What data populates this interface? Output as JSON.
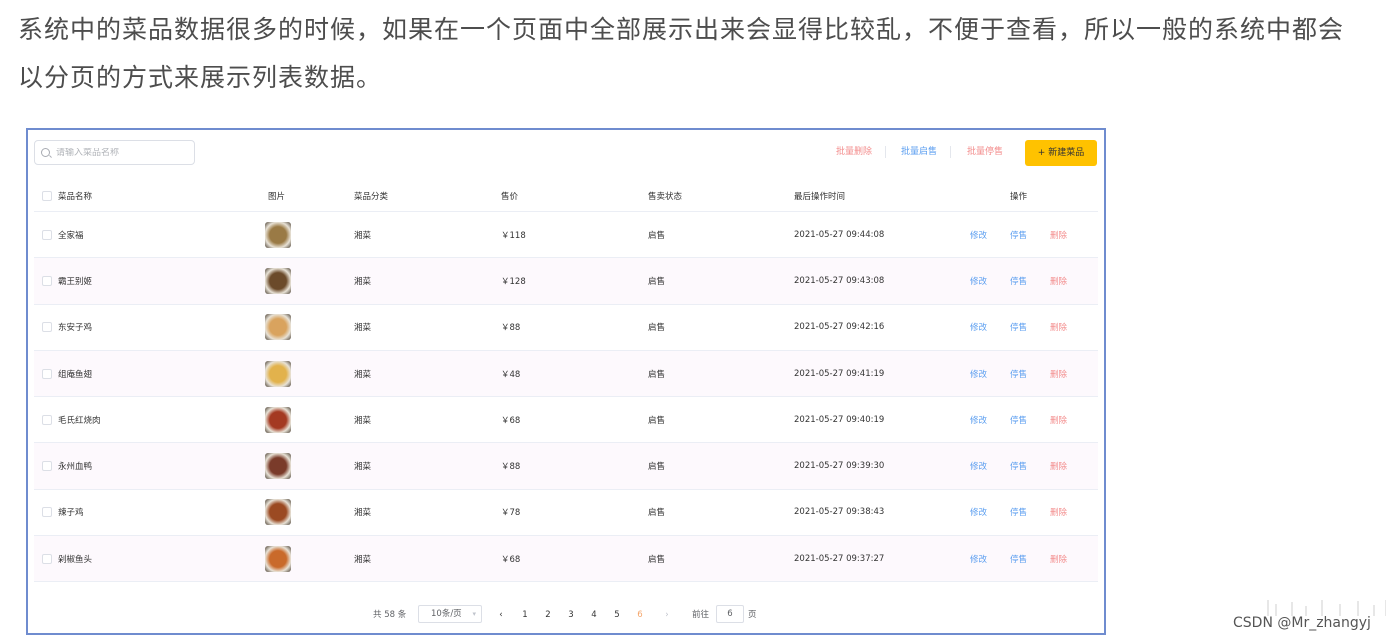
{
  "intro": "系统中的菜品数据很多的时候，如果在一个页面中全部展示出来会显得比较乱，不便于查看，所以一般的系统中都会以分页的方式来展示列表数据。",
  "toolbar": {
    "search_placeholder": "请输入菜品名称",
    "batch_delete": "批量删除",
    "batch_enable": "批量启售",
    "batch_disable": "批量停售",
    "new_dish": "+ 新建菜品"
  },
  "colors": {
    "accent": "#ffc200",
    "link": "#5b9ef0",
    "danger": "#f38d8d",
    "frame": "#6f8ccf"
  },
  "table": {
    "columns": [
      "菜品名称",
      "图片",
      "菜品分类",
      "售价",
      "售卖状态",
      "最后操作时间",
      "操作"
    ],
    "rows": [
      {
        "name": "全家福",
        "category": "湘菜",
        "price": "￥118",
        "status": "启售",
        "time": "2021-05-27 09:44:08",
        "edit": "修改",
        "toggle": "停售",
        "delete": "删除",
        "img_color": "#9a7a45"
      },
      {
        "name": "霸王别姬",
        "category": "湘菜",
        "price": "￥128",
        "status": "启售",
        "time": "2021-05-27 09:43:08",
        "edit": "修改",
        "toggle": "停售",
        "delete": "删除",
        "img_color": "#6b4a2a"
      },
      {
        "name": "东安子鸡",
        "category": "湘菜",
        "price": "￥88",
        "status": "启售",
        "time": "2021-05-27 09:42:16",
        "edit": "修改",
        "toggle": "停售",
        "delete": "删除",
        "img_color": "#d9a35e"
      },
      {
        "name": "组庵鱼翅",
        "category": "湘菜",
        "price": "￥48",
        "status": "启售",
        "time": "2021-05-27 09:41:19",
        "edit": "修改",
        "toggle": "停售",
        "delete": "删除",
        "img_color": "#e2b24c"
      },
      {
        "name": "毛氏红烧肉",
        "category": "湘菜",
        "price": "￥68",
        "status": "启售",
        "time": "2021-05-27 09:40:19",
        "edit": "修改",
        "toggle": "停售",
        "delete": "删除",
        "img_color": "#a43a22"
      },
      {
        "name": "永州血鸭",
        "category": "湘菜",
        "price": "￥88",
        "status": "启售",
        "time": "2021-05-27 09:39:30",
        "edit": "修改",
        "toggle": "停售",
        "delete": "删除",
        "img_color": "#7a3b2a"
      },
      {
        "name": "辣子鸡",
        "category": "湘菜",
        "price": "￥78",
        "status": "启售",
        "time": "2021-05-27 09:38:43",
        "edit": "修改",
        "toggle": "停售",
        "delete": "删除",
        "img_color": "#9b4a22"
      },
      {
        "name": "剁椒鱼头",
        "category": "湘菜",
        "price": "￥68",
        "status": "启售",
        "time": "2021-05-27 09:37:27",
        "edit": "修改",
        "toggle": "停售",
        "delete": "删除",
        "img_color": "#c96a2b"
      }
    ]
  },
  "pagination": {
    "total": "共 58 条",
    "page_size": "10条/页",
    "prev": "‹",
    "pages": [
      "1",
      "2",
      "3",
      "4",
      "5",
      "6"
    ],
    "current_page": "6",
    "next": "›",
    "goto_label": "前往",
    "goto_value": "6",
    "goto_unit": "页"
  },
  "watermark": "CSDN @Mr_zhangyj"
}
